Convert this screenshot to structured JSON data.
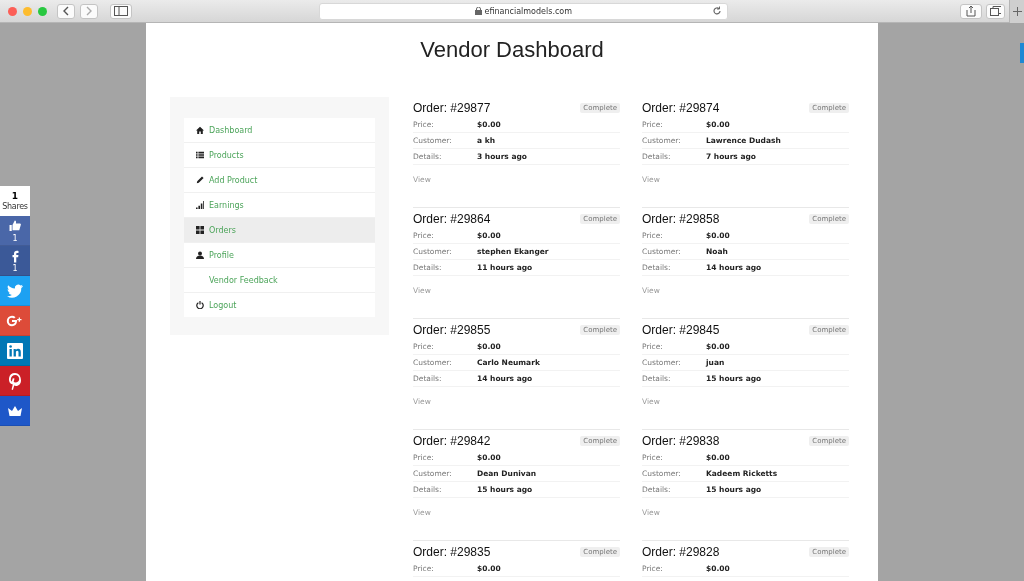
{
  "browser": {
    "address": "efinancialmodels.com"
  },
  "share_bar": {
    "total": "1",
    "total_label": "Shares",
    "buttons": [
      {
        "kind": "like",
        "count": "1"
      },
      {
        "kind": "facebook",
        "count": "1"
      },
      {
        "kind": "twitter"
      },
      {
        "kind": "googleplus"
      },
      {
        "kind": "linkedin"
      },
      {
        "kind": "pinterest"
      },
      {
        "kind": "crown"
      }
    ]
  },
  "page_title": "Vendor Dashboard",
  "sidebar": {
    "items": [
      {
        "label": "Dashboard",
        "selected": false
      },
      {
        "label": "Products",
        "selected": false
      },
      {
        "label": "Add Product",
        "selected": false
      },
      {
        "label": "Earnings",
        "selected": false
      },
      {
        "label": "Orders",
        "selected": true
      },
      {
        "label": "Profile",
        "selected": false,
        "children": [
          {
            "label": "Vendor Feedback",
            "selected": false
          }
        ]
      },
      {
        "label": "Logout",
        "selected": false
      }
    ]
  },
  "orders": [
    {
      "title": "Order: #29877",
      "status": "Complete",
      "fields": [
        [
          "Price:",
          "$0.00"
        ],
        [
          "Customer:",
          "a kh"
        ],
        [
          "Details:",
          "3 hours ago"
        ]
      ],
      "link": "View"
    },
    {
      "title": "Order: #29874",
      "status": "Complete",
      "fields": [
        [
          "Price:",
          "$0.00"
        ],
        [
          "Customer:",
          "Lawrence Dudash"
        ],
        [
          "Details:",
          "7 hours ago"
        ]
      ],
      "link": "View"
    },
    {
      "title": "Order: #29864",
      "status": "Complete",
      "fields": [
        [
          "Price:",
          "$0.00"
        ],
        [
          "Customer:",
          "stephen Ekanger"
        ],
        [
          "Details:",
          "11 hours ago"
        ]
      ],
      "link": "View"
    },
    {
      "title": "Order: #29858",
      "status": "Complete",
      "fields": [
        [
          "Price:",
          "$0.00"
        ],
        [
          "Customer:",
          "Noah"
        ],
        [
          "Details:",
          "14 hours ago"
        ]
      ],
      "link": "View"
    },
    {
      "title": "Order: #29855",
      "status": "Complete",
      "fields": [
        [
          "Price:",
          "$0.00"
        ],
        [
          "Customer:",
          "Carlo Neumark"
        ],
        [
          "Details:",
          "14 hours ago"
        ]
      ],
      "link": "View"
    },
    {
      "title": "Order: #29845",
      "status": "Complete",
      "fields": [
        [
          "Price:",
          "$0.00"
        ],
        [
          "Customer:",
          "juan"
        ],
        [
          "Details:",
          "15 hours ago"
        ]
      ],
      "link": "View"
    },
    {
      "title": "Order: #29842",
      "status": "Complete",
      "fields": [
        [
          "Price:",
          "$0.00"
        ],
        [
          "Customer:",
          "Dean Dunivan"
        ],
        [
          "Details:",
          "15 hours ago"
        ]
      ],
      "link": "View"
    },
    {
      "title": "Order: #29838",
      "status": "Complete",
      "fields": [
        [
          "Price:",
          "$0.00"
        ],
        [
          "Customer:",
          "Kadeem Ricketts"
        ],
        [
          "Details:",
          "15 hours ago"
        ]
      ],
      "link": "View"
    },
    {
      "title": "Order: #29835",
      "status": "Complete",
      "fields": [
        [
          "Price:",
          "$0.00"
        ]
      ]
    },
    {
      "title": "Order: #29828",
      "status": "Complete",
      "fields": [
        [
          "Price:",
          "$0.00"
        ]
      ]
    }
  ]
}
